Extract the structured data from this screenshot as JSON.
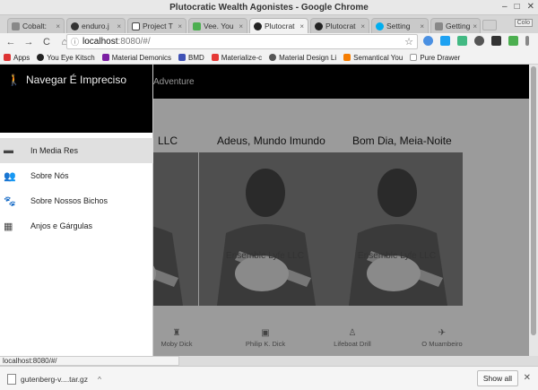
{
  "window": {
    "title": "Plutocratic Wealth Agonistes - Google Chrome",
    "min": "‒",
    "max": "□",
    "close": "✕"
  },
  "tabs": [
    {
      "label": "Cobalt: ",
      "color": "#888"
    },
    {
      "label": "enduro.j",
      "color": "#333"
    },
    {
      "label": "Project T",
      "color": "#444"
    },
    {
      "label": "Vee. You",
      "color": "#4caf50"
    },
    {
      "label": "Plutocrat",
      "color": "#222",
      "active": true
    },
    {
      "label": "Plutocrat",
      "color": "#222"
    },
    {
      "label": "Setting",
      "color": "#00aeef"
    },
    {
      "label": "Getting",
      "color": "#888"
    }
  ],
  "tab_close": "×",
  "tab_right": "Colo",
  "nav": {
    "back": "←",
    "forward": "→",
    "reload": "C",
    "home": "⌂"
  },
  "url": {
    "host": "localhost",
    "path": ":8080/#/",
    "star": "☆"
  },
  "bookmarks": [
    {
      "label": "Apps",
      "color": "#d33"
    },
    {
      "label": "You Eye Kitsch",
      "color": "#222"
    },
    {
      "label": "Material Demonics",
      "color": "#7b1fa2"
    },
    {
      "label": "BMD",
      "color": "#3f51b5"
    },
    {
      "label": "Materialize-c",
      "color": "#e53935"
    },
    {
      "label": "Material Design Li",
      "color": "#555"
    },
    {
      "label": "Semantical You",
      "color": "#f57c00"
    },
    {
      "label": "Pure Drawer",
      "color": "#bbb"
    }
  ],
  "app": {
    "brand": "Navegar É Impreciso",
    "brand_icon": "walking-icon",
    "section": "Adventure"
  },
  "drawer": {
    "items": [
      {
        "label": "In Media Res",
        "icon": "▬",
        "active": true
      },
      {
        "label": "Sobre Nós",
        "icon": "👥"
      },
      {
        "label": "Sobre Nossos Bichos",
        "icon": "🐾"
      },
      {
        "label": "Anjos e Gárgulas",
        "icon": "▦"
      }
    ]
  },
  "cards": [
    {
      "title": "LLC",
      "caption": "LLC"
    },
    {
      "title": "Adeus, Mundo Imundo",
      "caption": "Ensemble Lyfe LLC"
    },
    {
      "title": "Bom Dia, Meia-Noite",
      "caption": "Ensemble Lyfe LLC"
    }
  ],
  "bottom_nav": [
    {
      "label": "Moby Dick",
      "icon": "♜"
    },
    {
      "label": "Philip K. Dick",
      "icon": "▣"
    },
    {
      "label": "Lifeboat Drill",
      "icon": "♙"
    },
    {
      "label": "O Muambeiro",
      "icon": "✈"
    }
  ],
  "status_text": "localhost:8080/#/",
  "download": {
    "filename": "gutenberg-v....tar.gz",
    "chevron": "^",
    "show_all": "Show all",
    "close": "✕"
  }
}
